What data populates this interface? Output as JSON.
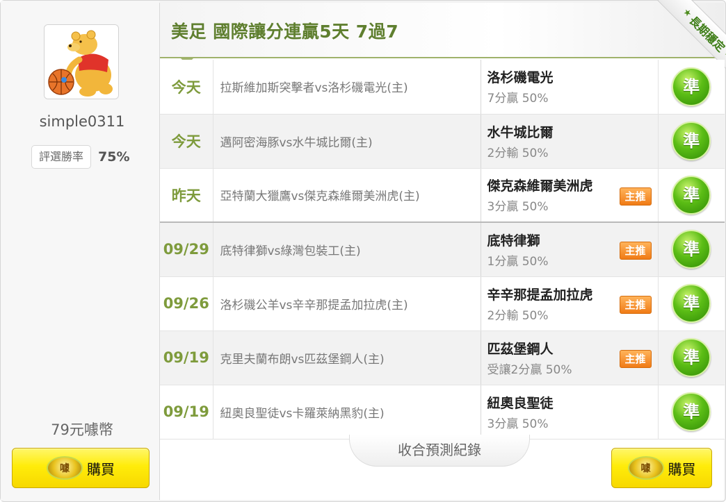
{
  "user": {
    "name": "simple0311",
    "rate_label": "評選勝率",
    "rate_value": "75%",
    "price": "79元噱幣",
    "buy_label": "購買"
  },
  "title": "美足 國際讓分連贏5天 7過7",
  "ribbon": "長期穩定",
  "collapse_label": "收合預測紀錄",
  "rows": [
    {
      "date": "今天",
      "match": "拉斯維加斯突擊者vs洛杉磯電光(主)",
      "team": "洛杉磯電光",
      "result": "7分贏 50%",
      "badge": "",
      "mark": "準"
    },
    {
      "date": "今天",
      "match": "邁阿密海豚vs水牛城比爾(主)",
      "team": "水牛城比爾",
      "result": "2分輸 50%",
      "badge": "",
      "mark": "準"
    },
    {
      "date": "昨天",
      "match": "亞特蘭大獵鷹vs傑克森維爾美洲虎(主)",
      "team": "傑克森維爾美洲虎",
      "result": "3分贏 50%",
      "badge": "主推",
      "mark": "準"
    },
    {
      "date": "09/29",
      "match": "底特律獅vs綠灣包裝工(主)",
      "team": "底特律獅",
      "result": "1分贏 50%",
      "badge": "主推",
      "mark": "準"
    },
    {
      "date": "09/26",
      "match": "洛杉磯公羊vs辛辛那提孟加拉虎(主)",
      "team": "辛辛那提孟加拉虎",
      "result": "2分輸 50%",
      "badge": "主推",
      "mark": "準"
    },
    {
      "date": "09/19",
      "match": "克里夫蘭布朗vs匹茲堡鋼人(主)",
      "team": "匹茲堡鋼人",
      "result": "受讓2分贏 50%",
      "badge": "主推",
      "mark": "準"
    },
    {
      "date": "09/19",
      "match": "紐奧良聖徒vs卡羅萊納黑豹(主)",
      "team": "紐奧良聖徒",
      "result": "3分贏 50%",
      "badge": "",
      "mark": "準"
    }
  ],
  "icons": {
    "avatar": "winnie-pooh-basketball-avatar",
    "coin": "gold-coin-icon",
    "result": "green-ball-icon"
  },
  "colors": {
    "title_green": "#5f7f2f",
    "date_green": "#7e9b3c",
    "badge_orange": "#f07b16",
    "buy_yellow": "#ffec0a",
    "result_green": "#5bbd15"
  }
}
